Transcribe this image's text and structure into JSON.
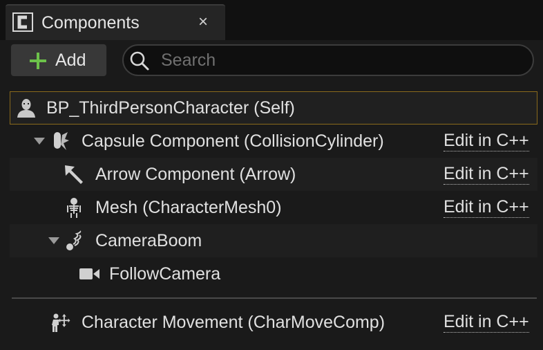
{
  "tab": {
    "title": "Components",
    "close_glyph": "×",
    "icon": "blueprint-class-icon"
  },
  "toolbar": {
    "add_label": "Add",
    "add_icon": "plus-icon",
    "search_placeholder": "Search",
    "search_value": ""
  },
  "colors": {
    "accent_green": "#6cc24a",
    "selection_border": "#8a6a1c",
    "text": "#e0e0e0",
    "panel_bg": "#1a1a1a"
  },
  "tree": {
    "root": {
      "label": "BP_ThirdPersonCharacter (Self)",
      "icon": "character-icon"
    },
    "items": [
      {
        "label": "Capsule Component (CollisionCylinder)",
        "icon": "capsule-icon",
        "action": "Edit in C++",
        "expanded": true
      },
      {
        "label": "Arrow Component (Arrow)",
        "icon": "arrow-icon",
        "action": "Edit in C++"
      },
      {
        "label": "Mesh (CharacterMesh0)",
        "icon": "skeleton-icon",
        "action": "Edit in C++"
      },
      {
        "label": "CameraBoom",
        "icon": "spring-arm-icon",
        "action": "",
        "expanded": true
      },
      {
        "label": "FollowCamera",
        "icon": "camera-icon",
        "action": ""
      }
    ],
    "movement": {
      "label": "Character Movement (CharMoveComp)",
      "icon": "movement-icon",
      "action": "Edit in C++"
    }
  }
}
